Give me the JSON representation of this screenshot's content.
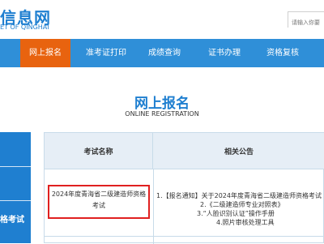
{
  "header": {
    "logo_title": "信息网",
    "logo_subtitle": "ET OF QINGHAI",
    "search_placeholder": "请输入你要"
  },
  "nav": {
    "items": [
      {
        "label": "网上报名",
        "active": true
      },
      {
        "label": "准考证打印",
        "active": false
      },
      {
        "label": "成绩查询",
        "active": false
      },
      {
        "label": "证书办理",
        "active": false
      },
      {
        "label": "资格复核",
        "active": false
      }
    ]
  },
  "main": {
    "title_cn": "网上报名",
    "title_en": "ONLINE REGISTRATION"
  },
  "sidebar": {
    "partial_label": "格考试"
  },
  "table": {
    "headers": [
      "考试名称",
      "相关公告"
    ],
    "exam_name": "2024年度青海省二级建造师资格考试",
    "notices": [
      "1.【报名通知】关于2024年度青海省二级建造师资格考试",
      "2.《二级建造师专业对照表》",
      "3.“人脸识别认证”操作手册",
      "4.照片审核处理工具"
    ]
  },
  "colors": {
    "brand_blue": "#1f7fd0",
    "nav_blue": "#2f8fd8",
    "active_orange": "#e8630f",
    "highlight_red": "#e02020"
  }
}
